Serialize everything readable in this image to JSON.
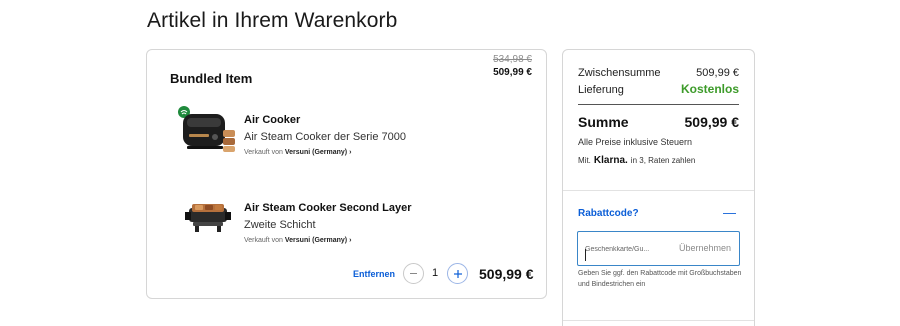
{
  "page": {
    "title": "Artikel in Ihrem Warenkorb"
  },
  "bundle": {
    "title": "Bundled Item",
    "old_price": "534,98 €",
    "new_price": "509,99 €",
    "remove_label": "Entfernen",
    "quantity": "1",
    "total": "509,99 €",
    "items": [
      {
        "name": "Air Cooker",
        "description": "Air Steam Cooker der Serie 7000",
        "seller_prefix": "Verkauft von",
        "seller_name": "Versuni (Germany) ›",
        "image_icon": "air-cooker-product-image"
      },
      {
        "name": "Air Steam Cooker Second Layer",
        "description": "Zweite Schicht",
        "seller_prefix": "Verkauft von",
        "seller_name": "Versuni (Germany) ›",
        "image_icon": "second-layer-product-image"
      }
    ]
  },
  "summary": {
    "subtotal_label": "Zwischensumme",
    "subtotal_value": "509,99 €",
    "shipping_label": "Lieferung",
    "shipping_value": "Kostenlos",
    "total_label": "Summe",
    "total_value": "509,99 €",
    "tax_note": "Alle Preise inklusive Steuern",
    "klarna_prefix": "Mit.",
    "klarna_logo": "Klarna.",
    "klarna_suffix": "in 3, Raten zahlen"
  },
  "coupon": {
    "title": "Rabattcode?",
    "toggle_symbol": "—",
    "placeholder": "Geschenkkarte/Gu...",
    "apply_label": "Übernehmen",
    "hint": "Geben Sie ggf. den Rabattcode mit Großbuchstaben und Bindestrichen ein"
  },
  "colors": {
    "accent": "#0b5ed7",
    "free_shipping": "#3d9b2a",
    "border": "#d6d6d6"
  }
}
